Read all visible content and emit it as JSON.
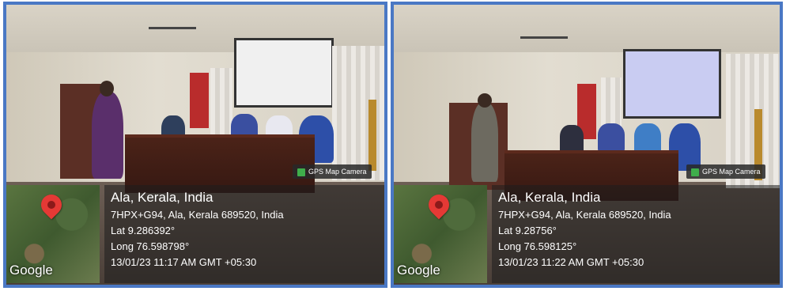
{
  "photos": [
    {
      "badge": "GPS Map Camera",
      "map_label": "Google",
      "place": "Ala, Kerala, India",
      "address": "7HPX+G94, Ala, Kerala 689520, India",
      "lat": "Lat 9.286392°",
      "long": "Long 76.598798°",
      "datetime": "13/01/23 11:17 AM GMT +05:30"
    },
    {
      "badge": "GPS Map Camera",
      "map_label": "Google",
      "place": "Ala, Kerala, India",
      "address": "7HPX+G94, Ala, Kerala 689520, India",
      "lat": "Lat 9.28756°",
      "long": "Long 76.598125°",
      "datetime": "13/01/23 11:22 AM GMT +05:30"
    }
  ],
  "colors": {
    "frame": "#4a78c4",
    "pin": "#e53935",
    "badge_icon": "#3fae4b"
  },
  "icons": [
    "map-pin-icon",
    "gps-camera-icon"
  ]
}
